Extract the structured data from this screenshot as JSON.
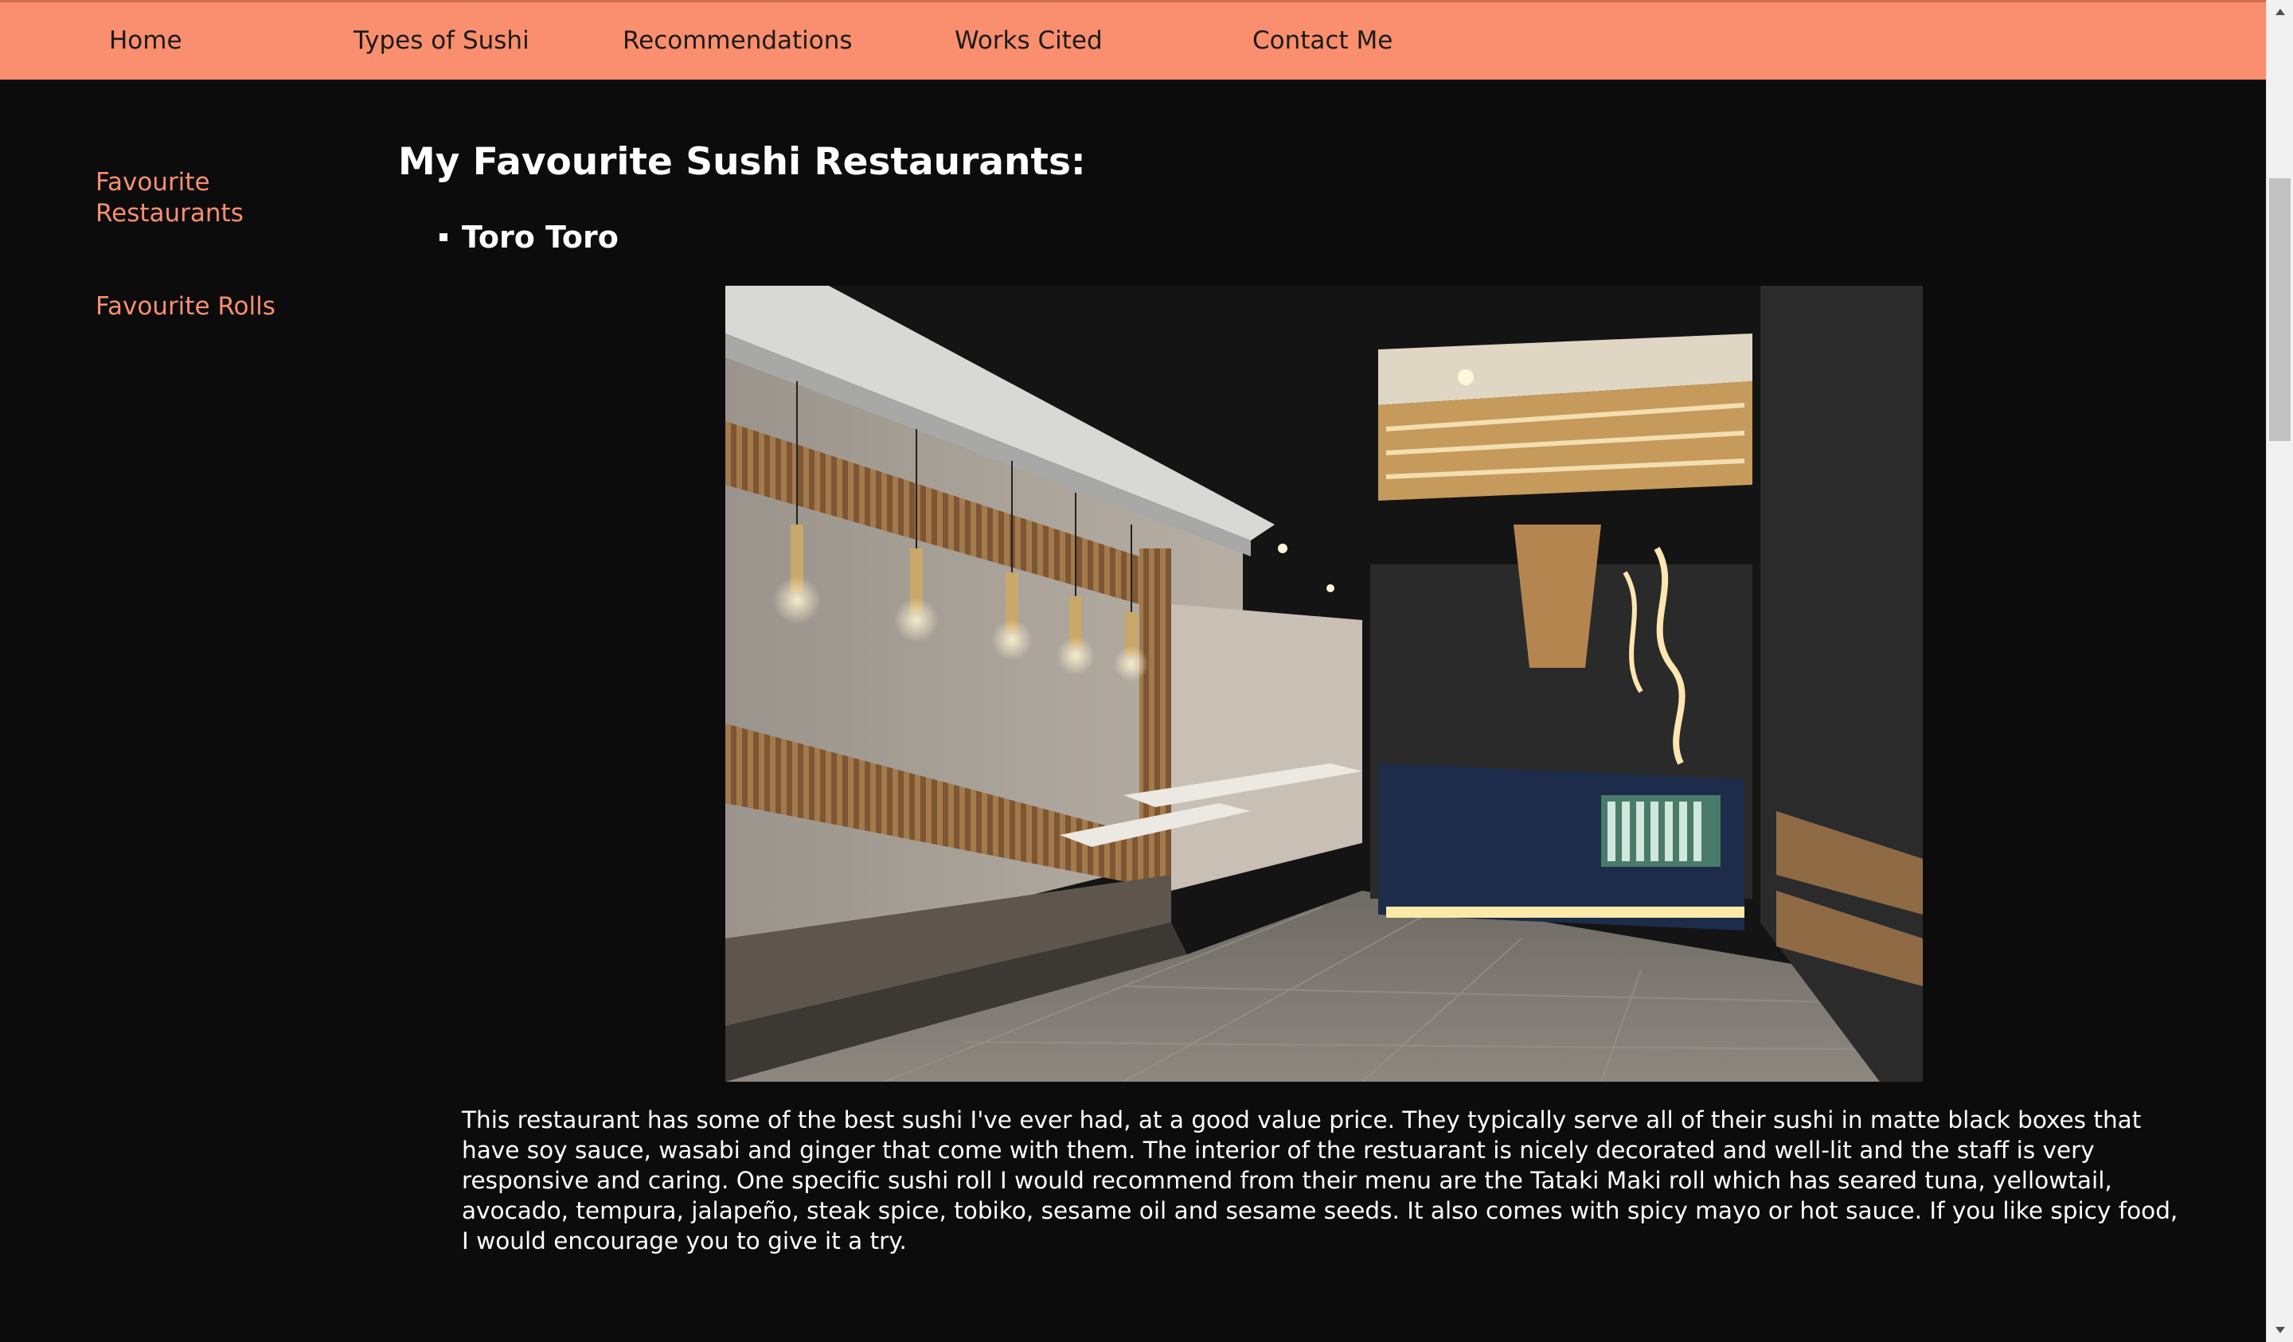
{
  "nav": {
    "items": [
      {
        "label": "Home"
      },
      {
        "label": "Types of Sushi"
      },
      {
        "label": "Recommendations"
      },
      {
        "label": "Works Cited"
      },
      {
        "label": "Contact Me"
      }
    ]
  },
  "sidebar": {
    "items": [
      {
        "label": "Favourite Restaurants"
      },
      {
        "label": "Favourite Rolls"
      }
    ]
  },
  "main": {
    "title": "My Favourite Sushi Restaurants:",
    "restaurant": {
      "name": "Toro Toro",
      "description": "This restaurant has some of the best sushi I've ever had, at a good value price. They typically serve all of their sushi in matte black boxes that have soy sauce, wasabi and ginger that come with them. The interior of the restuarant is nicely decorated and well-lit and the staff is very responsive and caring. One specific sushi roll I would recommend from their menu are the Tataki Maki roll which has seared tuna, yellowtail, avocado, tempura, jalapeño, steak spice, tobiko, sesame oil and sesame seeds. It also comes with spicy mayo or hot sauce. If you like spicy food, I would encourage you to give it a try."
    }
  },
  "colors": {
    "accent": "#f98f6e",
    "background": "#0c0c0d",
    "text": "#ffffff"
  }
}
